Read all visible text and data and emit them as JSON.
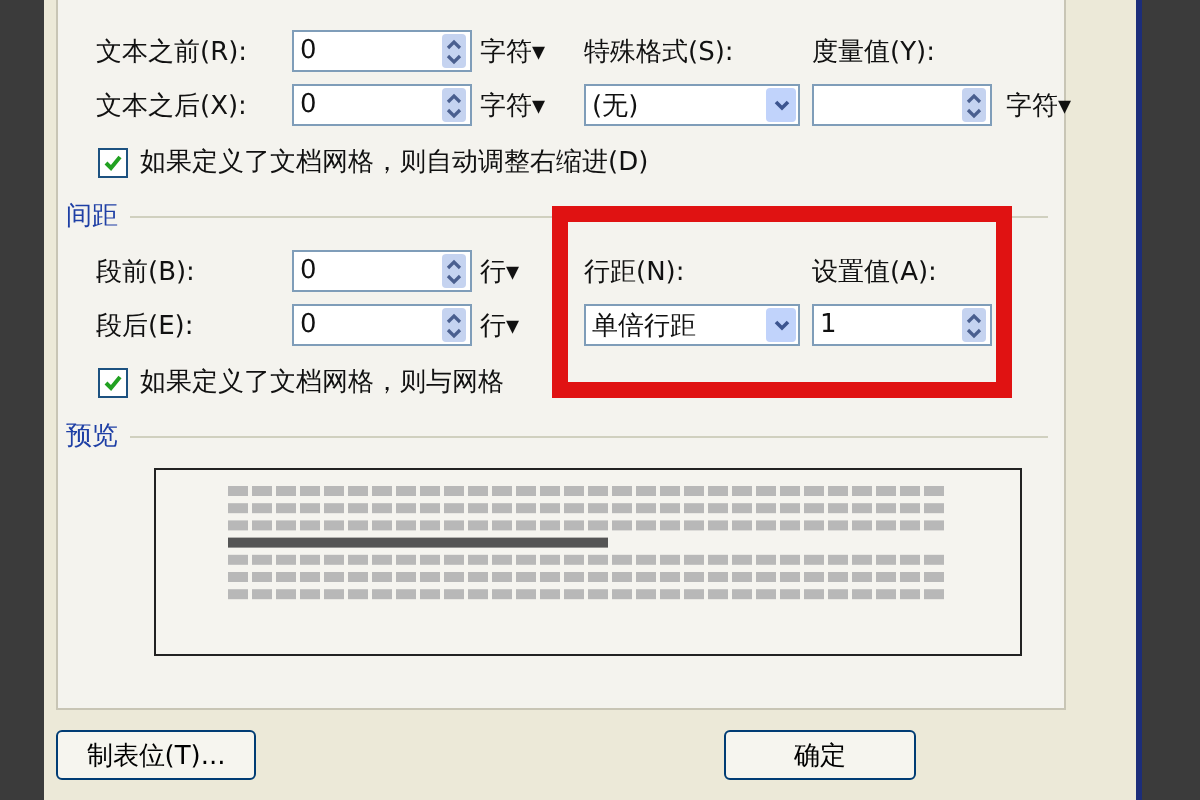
{
  "indent": {
    "rows": [
      {
        "label": "文本之前(R):",
        "value": "0",
        "unit": "字符▾"
      },
      {
        "label": "文本之后(X):",
        "value": "0",
        "unit": "字符▾"
      }
    ],
    "special": {
      "label": "特殊格式(S):",
      "value": "(无)"
    },
    "measure": {
      "label": "度量值(Y):",
      "unit": "字符▾"
    },
    "auto_adjust": {
      "label": "如果定义了文档网格，则自动调整右缩进(D)",
      "checked": true
    }
  },
  "spacing": {
    "heading": "间距",
    "rows": [
      {
        "label": "段前(B):",
        "value": "0",
        "unit": "行▾"
      },
      {
        "label": "段后(E):",
        "value": "0",
        "unit": "行▾"
      }
    ],
    "line_spacing": {
      "label": "行距(N):",
      "value": "单倍行距"
    },
    "setting": {
      "label": "设置值(A):",
      "value": "1"
    },
    "snap_grid": {
      "label": "如果定义了文档网格，则与网格",
      "checked": true
    }
  },
  "preview": {
    "heading": "预览"
  },
  "buttons": [
    "制表位(T)...",
    "确定"
  ]
}
